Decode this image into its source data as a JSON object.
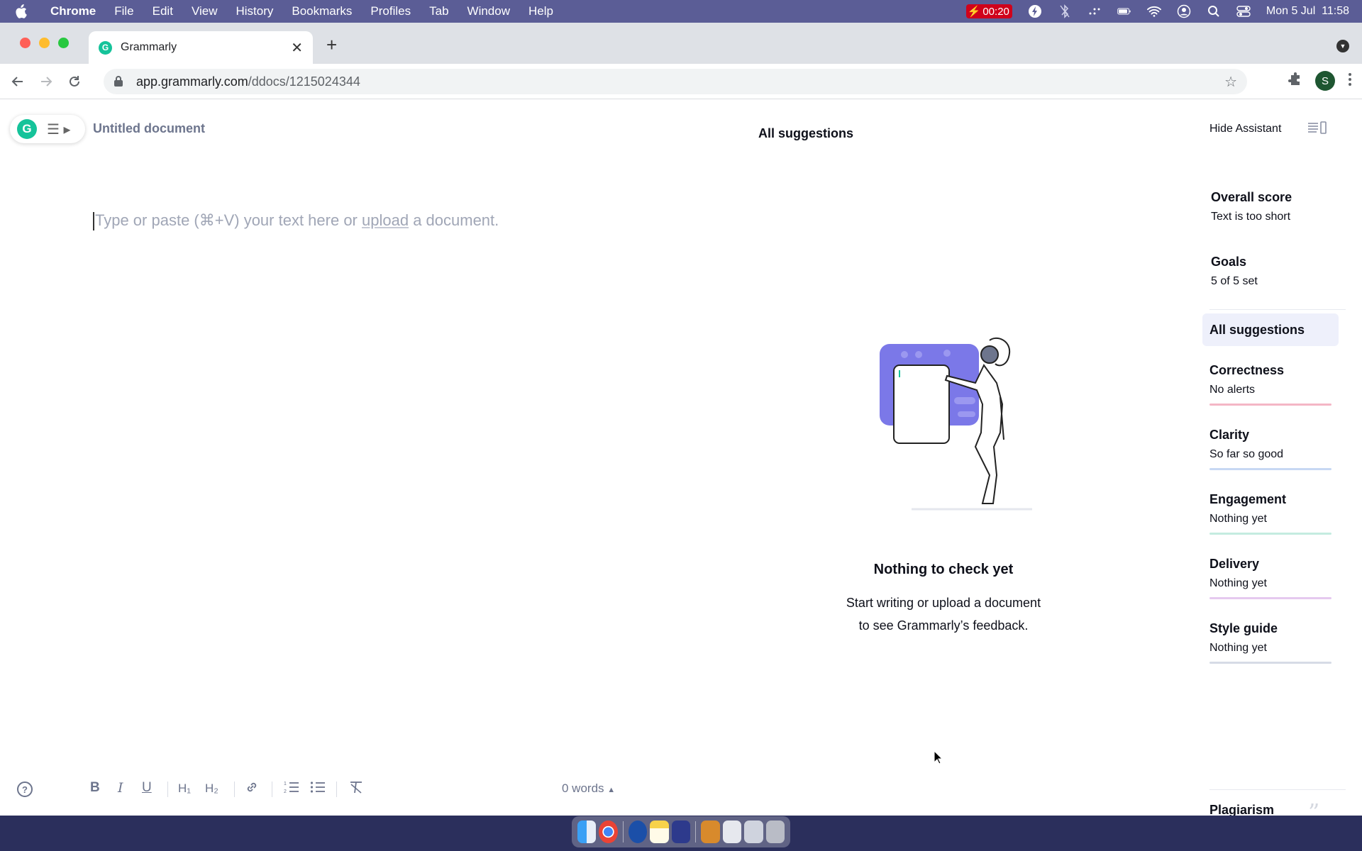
{
  "menubar": {
    "app_name": "Chrome",
    "items": [
      "File",
      "Edit",
      "View",
      "History",
      "Bookmarks",
      "Profiles",
      "Tab",
      "Window",
      "Help"
    ],
    "timer": "00:20",
    "clock": "Mon 5 Jul  11:58"
  },
  "browser": {
    "tab_title": "Grammarly",
    "url_host": "app.grammarly.com",
    "url_path": "/ddocs/1215024344",
    "profile_initial": "S"
  },
  "editor": {
    "doc_title": "Untitled document",
    "placeholder_before": "Type or paste (⌘+V) your text here or ",
    "placeholder_link": "upload",
    "placeholder_after": " a document.",
    "word_count": "0 words"
  },
  "suggestions": {
    "header": "All suggestions",
    "empty_title": "Nothing to check yet",
    "empty_line1": "Start writing or upload a document",
    "empty_line2": "to see Grammarly’s feedback."
  },
  "assistant": {
    "hide_label": "Hide Assistant",
    "overall_title": "Overall score",
    "overall_sub": "Text is too short",
    "goals_title": "Goals",
    "goals_sub": "5 of 5 set",
    "active_filter": "All suggestions",
    "categories": [
      {
        "title": "Correctness",
        "sub": "No alerts",
        "color": "#f4b6c6"
      },
      {
        "title": "Clarity",
        "sub": "So far so good",
        "color": "#c7d8f3"
      },
      {
        "title": "Engagement",
        "sub": "Nothing yet",
        "color": "#c4ece0"
      },
      {
        "title": "Delivery",
        "sub": "Nothing yet",
        "color": "#e5c9ef"
      },
      {
        "title": "Style guide",
        "sub": "Nothing yet",
        "color": "#d6dbe6"
      }
    ],
    "plagiarism": "Plagiarism"
  },
  "colors": {
    "grammarly_green": "#15c39a",
    "accent_purple": "#7b78e8",
    "menubar_bg": "#5b5d96"
  },
  "icons": [
    "apple-icon",
    "battery-icon",
    "wifi-icon",
    "search-icon",
    "back-icon",
    "forward-icon",
    "reload-icon",
    "lock-icon",
    "star-icon",
    "extensions-icon",
    "kebab-icon",
    "bold-icon",
    "italic-icon",
    "underline-icon",
    "h1-icon",
    "h2-icon",
    "link-icon",
    "ordered-list-icon",
    "bullet-list-icon",
    "clear-format-icon",
    "help-icon",
    "quote-icon"
  ]
}
